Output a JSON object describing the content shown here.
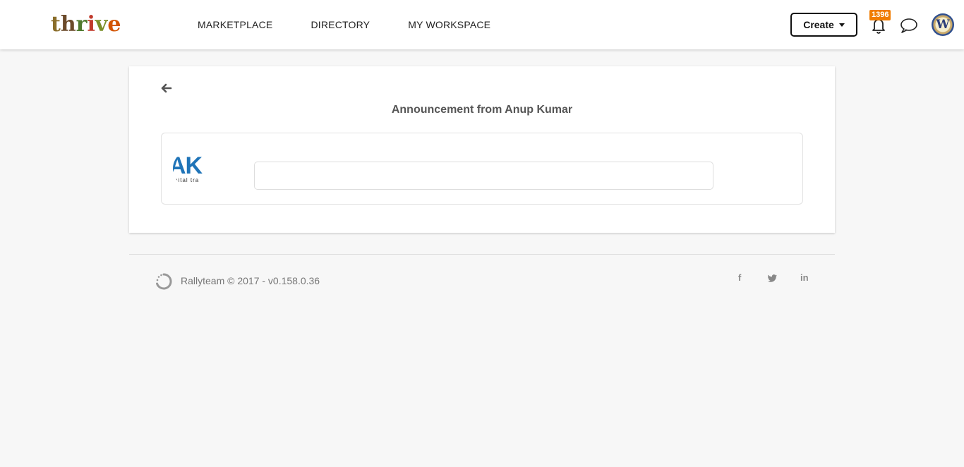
{
  "header": {
    "logo_letters": [
      "t",
      "h",
      "r",
      "i",
      "v",
      "e"
    ],
    "logo_colors": [
      "#8a6d2a",
      "#6b4a2a",
      "#4f7a2e",
      "#c0392b",
      "#7b8f2a",
      "#d35400"
    ],
    "nav": [
      "MARKETPLACE",
      "DIRECTORY",
      "MY WORKSPACE"
    ],
    "create_label": "Create",
    "notification_count": "1396",
    "avatar_initial": "W",
    "badge_color": "#f07c00"
  },
  "main": {
    "title": "Announcement from Anup Kumar",
    "org_avatar_text": "AK",
    "org_avatar_subtext": "pital tra"
  },
  "footer": {
    "text": "Rallyteam © 2017 - v0.158.0.36",
    "social": [
      "f",
      "twitter-icon",
      "in"
    ]
  }
}
